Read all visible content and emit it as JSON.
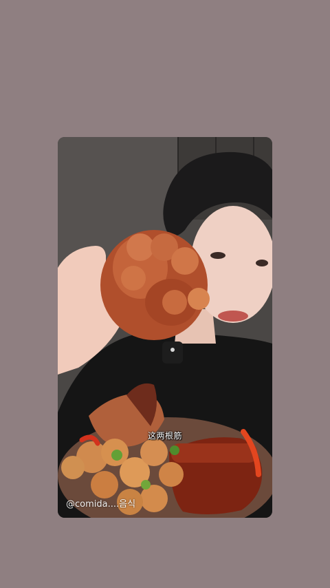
{
  "story": {
    "subtitle": "这两根筋",
    "watermark": "@comida....음식"
  },
  "colors": {
    "page_background": "#8f7f81",
    "subtitle_text": "#ffffff"
  }
}
